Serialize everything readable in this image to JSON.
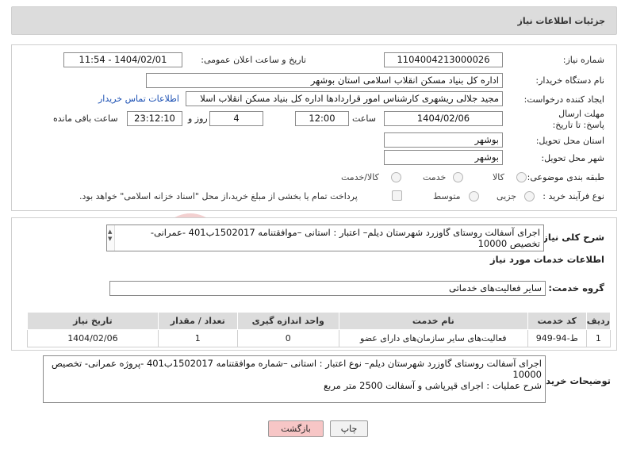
{
  "header": {
    "title": "جزئیات اطلاعات نیاز"
  },
  "form": {
    "need_number": {
      "label": "شماره نیاز:",
      "value": "1104004213000026"
    },
    "announce": {
      "label": "تاریخ و ساعت اعلان عمومی:",
      "value": "1404/02/01 - 11:54"
    },
    "buyer_org": {
      "label": "نام دستگاه خریدار:",
      "value": "اداره کل بنیاد مسکن انقلاب اسلامی استان بوشهر"
    },
    "creator": {
      "label": "ایجاد کننده درخواست:",
      "value": "مجید جلالی ریشهری کارشناس امور قراردادها اداره کل بنیاد مسکن انقلاب اسلا",
      "contact_link": "اطلاعات تماس خریدار"
    },
    "deadline": {
      "label": "مهلت ارسال پاسخ: تا تاریخ:",
      "date": "1404/02/06",
      "time_label": "ساعت",
      "time": "12:00",
      "days": "4",
      "days_label": "روز و",
      "remaining": "23:12:10",
      "remaining_label": "ساعت باقی مانده"
    },
    "province": {
      "label": "استان محل تحویل:",
      "value": "بوشهر"
    },
    "city": {
      "label": "شهر محل تحویل:",
      "value": "بوشهر"
    },
    "category": {
      "label": "طبقه بندی موضوعی:",
      "options": [
        "کالا",
        "خدمت",
        "کالا/خدمت"
      ],
      "selected": "خدمت"
    },
    "process": {
      "label": "نوع فرآیند خرید :",
      "options": [
        "جزیی",
        "متوسط"
      ],
      "note": "پرداخت تمام یا بخشی از مبلغ خرید،از محل \"اسناد خزانه اسلامی\" خواهد بود."
    }
  },
  "summary": {
    "label": "شرح کلی نیاز:",
    "text": "اجرای آسفالت روستای گاوزرد  شهرستان دیلم– اعتبار : استانی –موافقتنامه 1502017ب401 -عمرانی- تخصیص 10000"
  },
  "services": {
    "section_title": "اطلاعات خدمات مورد نیاز",
    "group_label": "گروه خدمت:",
    "group_value": "سایر فعالیت‌های خدماتی",
    "table": {
      "headers": [
        "ردیف",
        "کد خدمت",
        "نام خدمت",
        "واحد اندازه گیری",
        "تعداد / مقدار",
        "تاریخ نیاز"
      ],
      "rows": [
        [
          "1",
          "ط-94-949",
          "فعالیت‌های سایر سازمان‌های دارای عضو",
          "0",
          "1",
          "1404/02/06"
        ]
      ]
    }
  },
  "buyer_notes": {
    "label": "توضیحات خریدار:",
    "line1": "اجرای آسفالت روستای گاوزرد  شهرستان دیلم– نوع اعتبار : استانی –شماره موافقتنامه 1502017ب401 -پروژه عمرانی- تخصیص 10000",
    "line2": "شرح عملیات : اجرای قیرپاشی و آسفالت 2500 متر مربع"
  },
  "buttons": {
    "print": "چاپ",
    "back": "بازگشت"
  },
  "watermark": {
    "text": "AriaTender.net"
  },
  "colors": {
    "header_bg": "#dcdcdc",
    "link": "#1a4fb3",
    "back_button": "#f7c6c6"
  }
}
